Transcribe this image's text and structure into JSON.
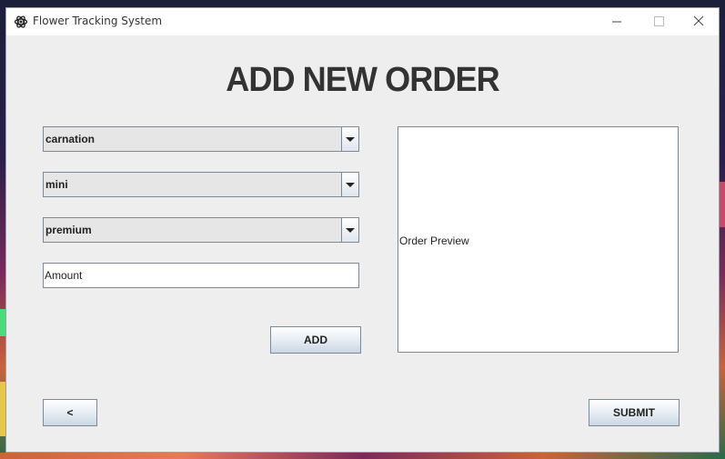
{
  "window": {
    "title": "Flower Tracking System",
    "controls": {
      "minimize": "minimize-icon",
      "maximize": "maximize-icon",
      "close": "close-icon"
    }
  },
  "form": {
    "heading": "ADD NEW ORDER",
    "flower_select": {
      "value": "carnation"
    },
    "size_select": {
      "value": "mini"
    },
    "grade_select": {
      "value": "premium"
    },
    "amount_input": {
      "value": "Amount"
    },
    "add_button": "ADD",
    "back_button": "<",
    "submit_button": "SUBMIT"
  },
  "preview": {
    "text": "Order Preview"
  },
  "colors": {
    "window_bg": "#eeeeee",
    "border": "#7a8a99",
    "heading": "#333333"
  }
}
